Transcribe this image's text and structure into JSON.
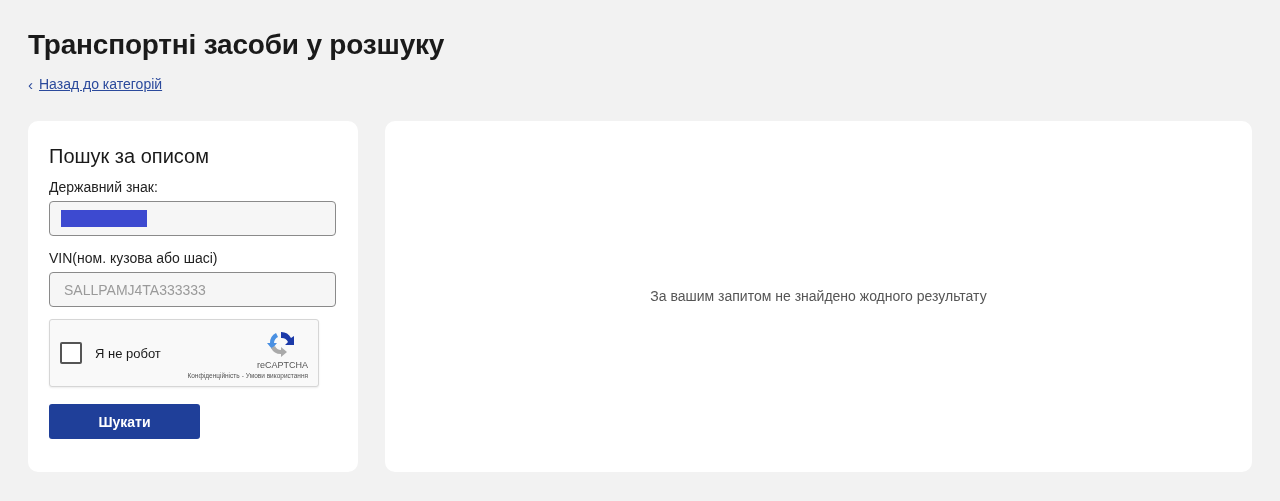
{
  "page_title": "Транспортні засоби у розшуку",
  "back_link": {
    "icon": "‹",
    "label": "Назад до категорій"
  },
  "search_form": {
    "title": "Пошук за описом",
    "fields": [
      {
        "label": "Державний знак:",
        "redacted": true
      },
      {
        "label": "VIN(ном. кузова або шасі)",
        "placeholder": "SALLPAMJ4TA333333",
        "redacted": false
      }
    ],
    "captcha": {
      "label": "Я не робот",
      "checked": false,
      "brand": "reCAPTCHA",
      "privacy": "Конфіденційність",
      "separator": "-",
      "terms": "Умови використання"
    },
    "submit": "Шукати"
  },
  "results": {
    "message": "За вашим запитом не знайдено жодного результату"
  }
}
